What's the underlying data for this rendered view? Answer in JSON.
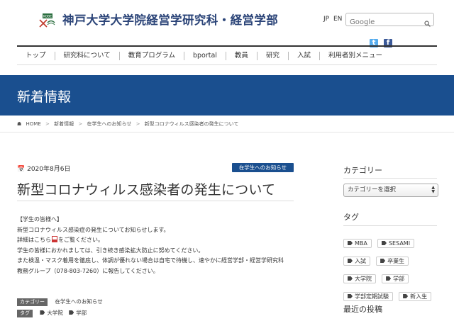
{
  "header": {
    "site_title": "神戸大学大学院経営学研究科・経営学部",
    "logo_text": "KOBE",
    "lang": [
      "JP",
      "EN"
    ],
    "search_placeholder": "Google",
    "social": [
      {
        "name": "twitter",
        "glyph": "t",
        "color": "#55acee"
      },
      {
        "name": "facebook",
        "glyph": "f",
        "color": "#3b5998"
      }
    ]
  },
  "nav": [
    "トップ",
    "研究科について",
    "教育プログラム",
    "bportal",
    "教員",
    "研究",
    "入試",
    "利用者別メニュー"
  ],
  "banner": {
    "title": "新着情報",
    "color": "#1a4f8f"
  },
  "breadcrumb": [
    "HOME",
    "新着情報",
    "在学生へのお知らせ",
    "新型コロナウィルス感染者の発生について"
  ],
  "post": {
    "date": "2020年8月6日",
    "category_badge": "在学生へのお知らせ",
    "title": "新型コロナウィルス感染者の発生について",
    "body": {
      "line1": "【学生の皆様へ】",
      "line2": "新型コロナウィルス感染症の発生についてお知らせします。",
      "line3_pre": "詳細はこちら",
      "line3_post": "をご覧ください。",
      "line4": "学生の皆様におかれましては、引き続き感染拡大防止に努めてください。",
      "line5": "また検温・マスク着用を徹底し、体調が優れない場合は自宅で待機し、速やかに経営学部・経営学研究科",
      "line6": "教務グループ（078-803-7260）に報告してください。"
    },
    "meta": {
      "category_label": "カテゴリー",
      "category_value": "在学生へのお知らせ",
      "tag_label": "タグ",
      "tags": [
        "大学院",
        "学部"
      ]
    }
  },
  "sidebar": {
    "category_heading": "カテゴリー",
    "category_select": "カテゴリーを選択",
    "tag_heading": "タグ",
    "tags": [
      "MBA",
      "SESAMI",
      "入試",
      "卒業生",
      "大学院",
      "学部",
      "学部定期試験",
      "新入生"
    ],
    "recent_heading": "最近の投稿"
  }
}
